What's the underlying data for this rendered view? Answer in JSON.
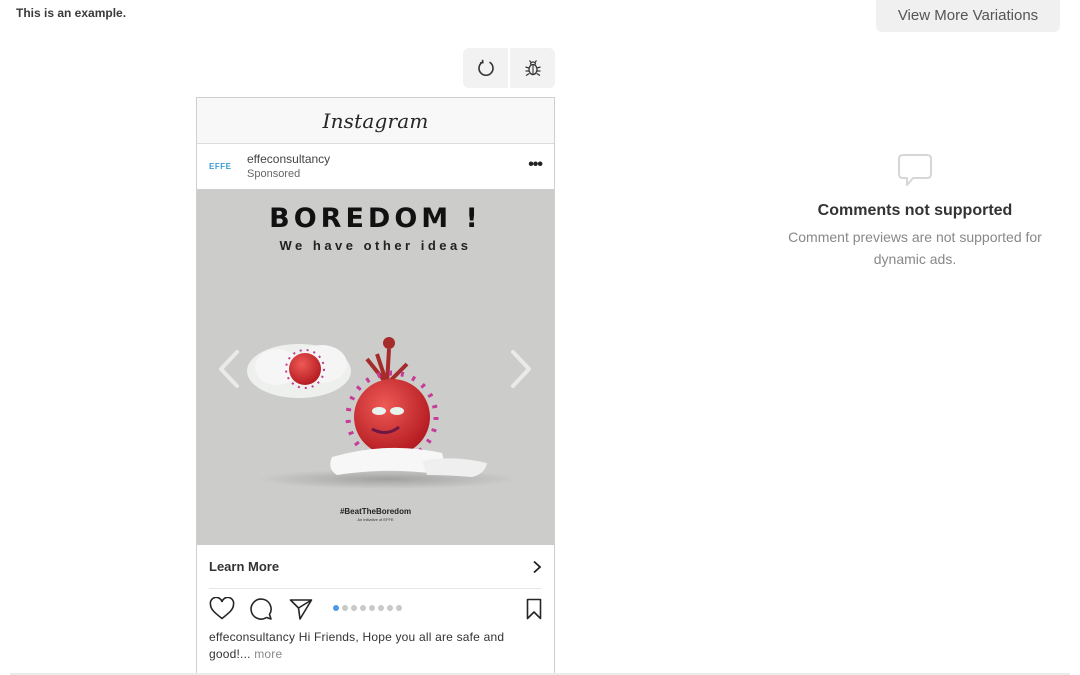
{
  "page": {
    "example_label": "This is an example.",
    "view_more_variations": "View More Variations"
  },
  "toolbar": {
    "refresh_icon": "refresh-icon",
    "bug_icon": "bug-icon"
  },
  "preview": {
    "platform_title": "Instagram",
    "account": {
      "logo_text": "EFFE",
      "username": "effeconsultancy",
      "sponsored": "Sponsored"
    },
    "media": {
      "headline": "BOREDOM !",
      "subhead": "We have other ideas",
      "hashtag": "#BeatTheBoredom",
      "initiative": "An initiative of EFFE",
      "background_color": "#cccdcb"
    },
    "cta": {
      "label": "Learn More"
    },
    "carousel": {
      "total_slides": 8,
      "active_slide": 1,
      "active_color": "#4c9ae8"
    },
    "caption": {
      "username": "effeconsultancy",
      "text": " Hi Friends, Hope you all are safe and good!...",
      "more": "more"
    }
  },
  "comments_panel": {
    "title": "Comments not supported",
    "description": "Comment previews are not supported for dynamic ads."
  }
}
